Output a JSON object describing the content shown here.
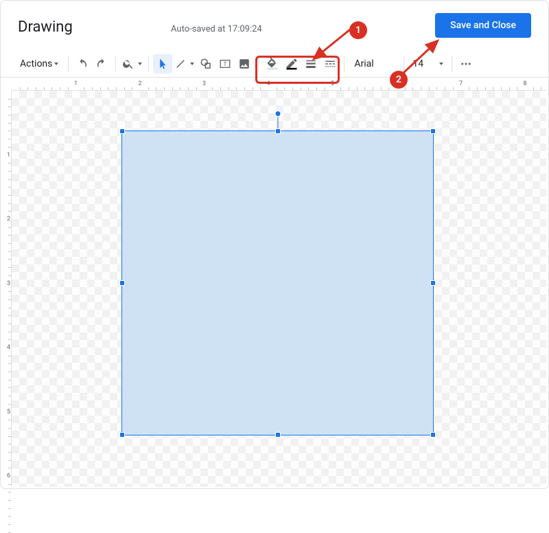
{
  "header": {
    "title": "Drawing",
    "autosave": "Auto-saved at 17:09:24",
    "save_button": "Save and Close"
  },
  "toolbar": {
    "actions": "Actions",
    "font": "Arial",
    "font_size": "14"
  },
  "ruler": {
    "h_labels": [
      "1",
      "2",
      "3",
      "4",
      "5",
      "6",
      "7",
      "8"
    ],
    "v_labels": [
      "1",
      "2",
      "3",
      "4",
      "5",
      "6"
    ]
  },
  "annotations": {
    "callout1": "1",
    "callout2": "2"
  }
}
